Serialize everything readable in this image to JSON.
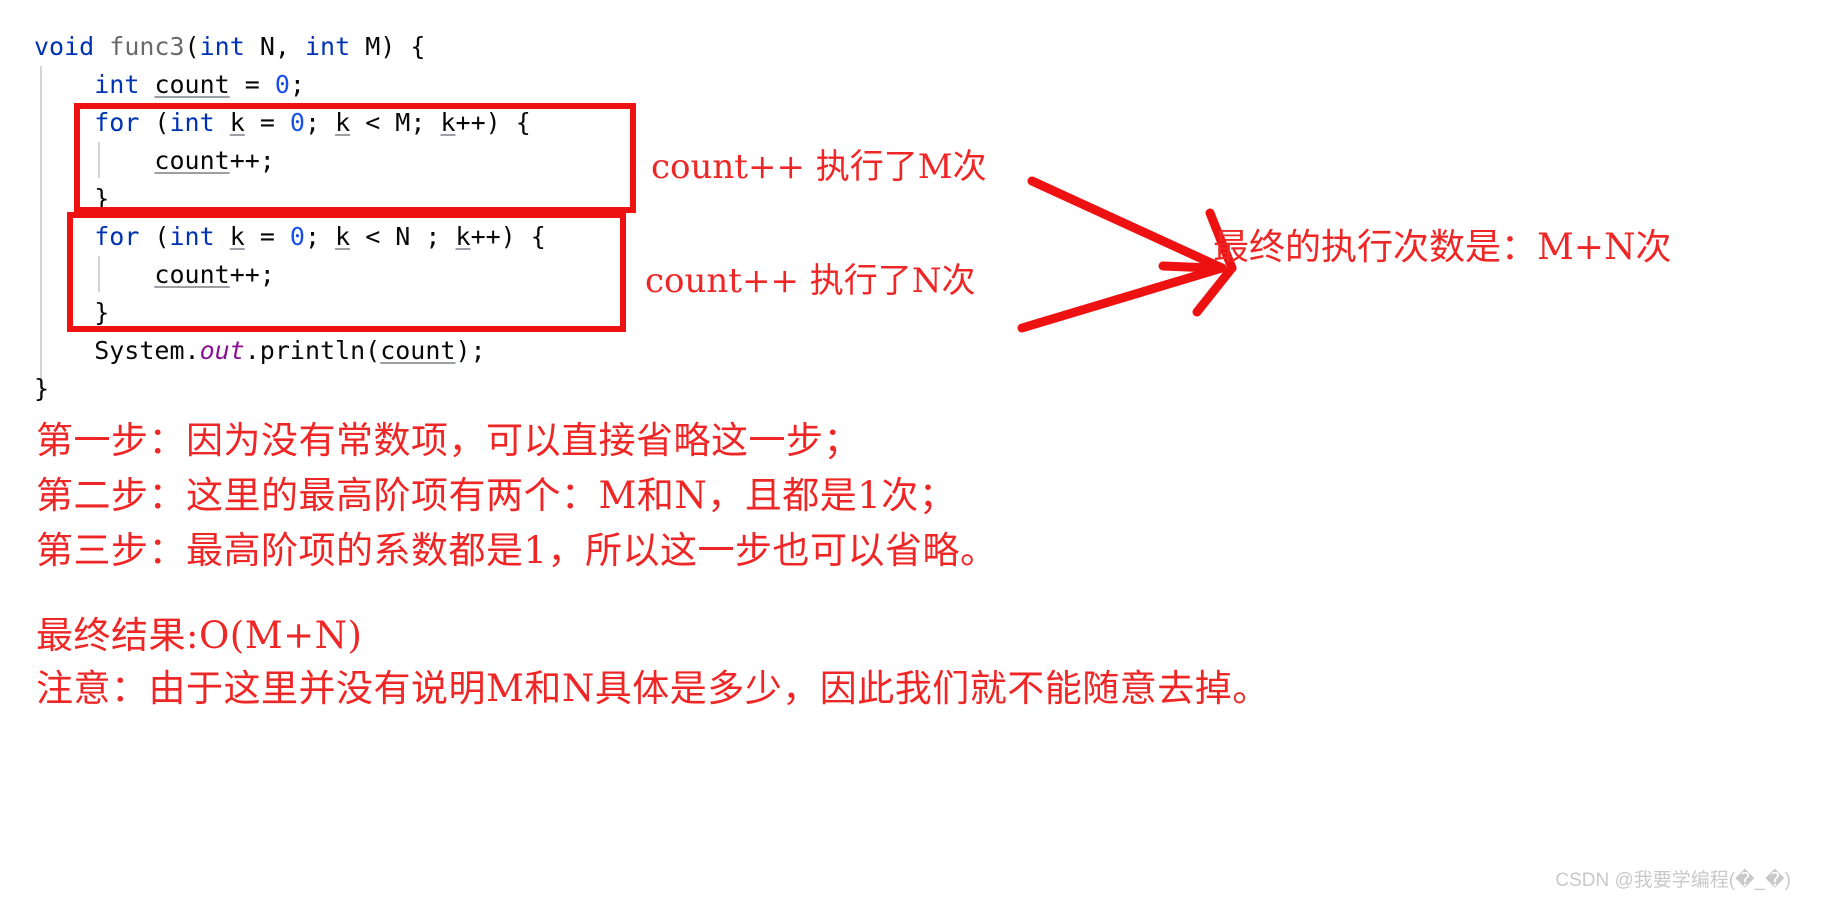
{
  "code": {
    "language": "java",
    "lines": [
      [
        {
          "t": "void",
          "c": "kw"
        },
        {
          "t": " ",
          "c": "plain"
        },
        {
          "t": "func3",
          "c": "fn"
        },
        {
          "t": "(",
          "c": "plain"
        },
        {
          "t": "int",
          "c": "kw"
        },
        {
          "t": " N, ",
          "c": "plain"
        },
        {
          "t": "int",
          "c": "kw"
        },
        {
          "t": " M) {",
          "c": "plain"
        }
      ],
      [
        {
          "t": "    ",
          "c": "plain"
        },
        {
          "t": "int",
          "c": "kw"
        },
        {
          "t": " ",
          "c": "plain"
        },
        {
          "t": "count",
          "c": "var"
        },
        {
          "t": " = ",
          "c": "plain"
        },
        {
          "t": "0",
          "c": "num"
        },
        {
          "t": ";",
          "c": "plain"
        }
      ],
      [
        {
          "t": "    ",
          "c": "plain"
        },
        {
          "t": "for",
          "c": "kw"
        },
        {
          "t": " (",
          "c": "plain"
        },
        {
          "t": "int",
          "c": "kw"
        },
        {
          "t": " ",
          "c": "plain"
        },
        {
          "t": "k",
          "c": "var"
        },
        {
          "t": " = ",
          "c": "plain"
        },
        {
          "t": "0",
          "c": "num"
        },
        {
          "t": "; ",
          "c": "plain"
        },
        {
          "t": "k",
          "c": "var"
        },
        {
          "t": " < M; ",
          "c": "plain"
        },
        {
          "t": "k",
          "c": "var"
        },
        {
          "t": "++) {",
          "c": "plain"
        }
      ],
      [
        {
          "t": "        ",
          "c": "plain"
        },
        {
          "t": "count",
          "c": "var"
        },
        {
          "t": "++;",
          "c": "plain"
        }
      ],
      [
        {
          "t": "    }",
          "c": "plain"
        }
      ],
      [
        {
          "t": "    ",
          "c": "plain"
        },
        {
          "t": "for",
          "c": "kw"
        },
        {
          "t": " (",
          "c": "plain"
        },
        {
          "t": "int",
          "c": "kw"
        },
        {
          "t": " ",
          "c": "plain"
        },
        {
          "t": "k",
          "c": "var"
        },
        {
          "t": " = ",
          "c": "plain"
        },
        {
          "t": "0",
          "c": "num"
        },
        {
          "t": "; ",
          "c": "plain"
        },
        {
          "t": "k",
          "c": "var"
        },
        {
          "t": " < N ; ",
          "c": "plain"
        },
        {
          "t": "k",
          "c": "var"
        },
        {
          "t": "++) {",
          "c": "plain"
        }
      ],
      [
        {
          "t": "        ",
          "c": "plain"
        },
        {
          "t": "count",
          "c": "var"
        },
        {
          "t": "++;",
          "c": "plain"
        }
      ],
      [
        {
          "t": "    }",
          "c": "plain"
        }
      ],
      [
        {
          "t": "    System.",
          "c": "plain"
        },
        {
          "t": "out",
          "c": "field"
        },
        {
          "t": ".println(",
          "c": "plain"
        },
        {
          "t": "count",
          "c": "var"
        },
        {
          "t": ");",
          "c": "plain"
        }
      ],
      [
        {
          "t": "}",
          "c": "plain"
        }
      ]
    ]
  },
  "annotations": {
    "loop_m_label": "count++ 执行了M次",
    "loop_n_label": "count++ 执行了N次",
    "total_label": "最终的执行次数是：M+N次",
    "box_color": "#ee1111",
    "text_color": "#ef2626"
  },
  "steps": {
    "step1": "第一步：因为没有常数项，可以直接省略这一步；",
    "step2": "第二步：这里的最高阶项有两个：M和N，且都是1次；",
    "step3": "第三步：最高阶项的系数都是1，所以这一步也可以省略。",
    "result": "最终结果:O(M+N)",
    "note": "注意：由于这里并没有说明M和N具体是多少，因此我们就不能随意去掉。"
  },
  "watermark": {
    "text": "CSDN @我要学编程(�_�)"
  }
}
